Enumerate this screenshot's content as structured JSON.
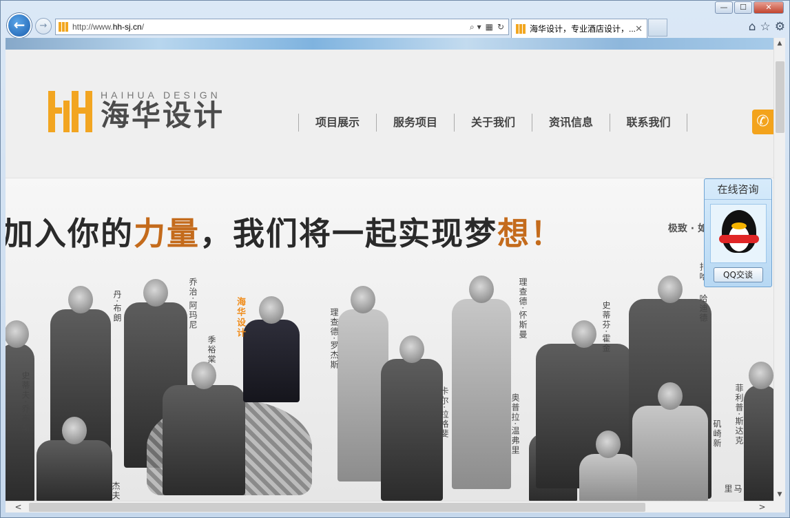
{
  "window": {
    "minimize_glyph": "—",
    "maximize_glyph": "☐",
    "close_glyph": "✕"
  },
  "nav": {
    "back_icon": "back-arrow-icon",
    "back_glyph": "←",
    "forward_glyph": "→"
  },
  "address_bar": {
    "url_prefix": "http://www.",
    "url_domain": "hh-sj.cn",
    "url_suffix": "/",
    "search_glyph": "⌕ ▾",
    "compat_glyph": "▦",
    "refresh_glyph": "↻"
  },
  "tab": {
    "title": "海华设计，专业酒店设计，...",
    "close_glyph": "✕"
  },
  "toolbar": {
    "home_glyph": "⌂",
    "favorites_glyph": "☆",
    "settings_glyph": "⚙"
  },
  "site": {
    "logo_en": "HAIHUA DESIGN",
    "logo_cn": "海华设计",
    "brand_color": "#f2a521",
    "menu": [
      {
        "label": "项目展示"
      },
      {
        "label": "服务项目"
      },
      {
        "label": "关于我们"
      },
      {
        "label": "资讯信息"
      },
      {
        "label": "联系我们"
      }
    ],
    "phone_glyph": "✆"
  },
  "banner": {
    "slogan_a": "加入你的",
    "slogan_b": "力量",
    "slogan_c": "，我们将一起实现梦",
    "slogan_d": "想",
    "slogan_e": "！",
    "right_text": "极致 · 如",
    "names": [
      {
        "text": "史蒂夫·乔布斯"
      },
      {
        "text": "丹·布朗"
      },
      {
        "text": "乔治·阿玛尼"
      },
      {
        "text": "季裕棠"
      },
      {
        "text": "海华设计"
      },
      {
        "text": "理查德·罗杰斯"
      },
      {
        "text": "卡尔·拉格斐"
      },
      {
        "text": "理查德·怀斯曼"
      },
      {
        "text": "奥普拉·温弗里"
      },
      {
        "text": "史蒂芬·霍金"
      },
      {
        "text": "哈迪德"
      },
      {
        "text": "扎哈"
      },
      {
        "text": "菲利普·斯达克"
      },
      {
        "text": "矶崎新"
      },
      {
        "text": "杰夫"
      },
      {
        "text": "马里"
      }
    ]
  },
  "qq_widget": {
    "title": "在线咨询",
    "button": "QQ交谈"
  },
  "scrollbars": {
    "up_glyph": "▲",
    "down_glyph": "▼",
    "left_glyph": "<",
    "right_glyph": ">"
  }
}
